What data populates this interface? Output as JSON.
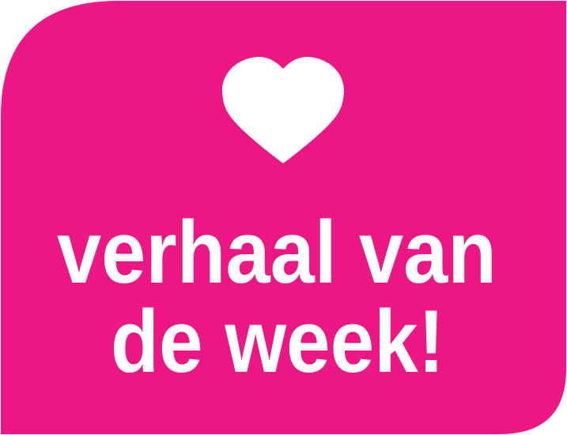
{
  "badge": {
    "background_color": "#EC1684",
    "foreground_color": "#FFFFFF",
    "icon": "heart-icon",
    "line1": "verhaal van",
    "line2": "de week!"
  }
}
